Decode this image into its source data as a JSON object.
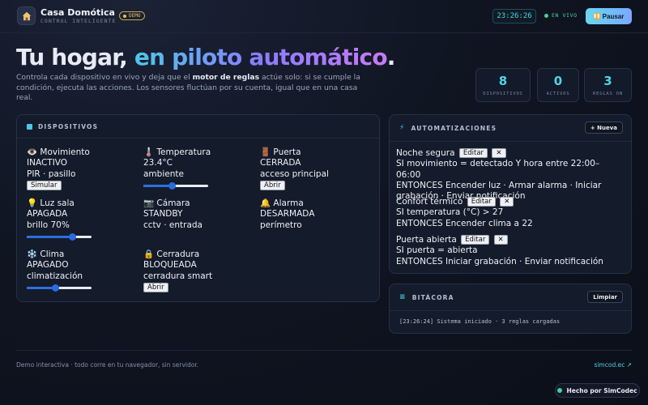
{
  "header": {
    "app_title": "Casa Domótica",
    "app_subtitle": "CONTROL INTELIGENTE",
    "badge": "DEMO",
    "clock": "23:26:26",
    "live": "EN VIVO",
    "pause_label": "Pausar"
  },
  "hero": {
    "title_plain": "Tu hogar, ",
    "title_accent": "en piloto automático",
    "title_end": ".",
    "desc_1": "Controla cada dispositivo en vivo y deja que el ",
    "desc_bold": "motor de reglas",
    "desc_2": " actúe solo: si se cumple la condición, ejecuta las acciones. Los sensores fluctúan por su cuenta, igual que en una casa real."
  },
  "stats": [
    {
      "value": "8",
      "label": "DISPOSITIVOS"
    },
    {
      "value": "0",
      "label": "ACTIVOS"
    },
    {
      "value": "3",
      "label": "REGLAS ON"
    }
  ],
  "devices_panel": {
    "title": "DISPOSITIVOS",
    "items": [
      {
        "icon": "👁️",
        "name": "Movimiento",
        "state": "INACTIVO",
        "detail": "PIR · pasillo",
        "button": "Simular"
      },
      {
        "icon": "🌡️",
        "name": "Temperatura",
        "state": "23.4°C",
        "detail": "ambiente",
        "slider": 0.44
      },
      {
        "icon": "🚪",
        "name": "Puerta",
        "state": "CERRADA",
        "detail": "acceso principal",
        "button": "Abrir"
      },
      {
        "icon": "💡",
        "name": "Luz sala",
        "state": "APAGADA",
        "detail": "brillo 70%",
        "slider": 0.7
      },
      {
        "icon": "📷",
        "name": "Cámara",
        "state": "STANDBY",
        "detail": "cctv · entrada"
      },
      {
        "icon": "🔔",
        "name": "Alarma",
        "state": "DESARMADA",
        "detail": "perímetro"
      },
      {
        "icon": "❄️",
        "name": "Clima",
        "state": "APAGADO",
        "detail": "climatización",
        "slider": 0.44
      },
      {
        "icon": "🔒",
        "name": "Cerradura",
        "state": "BLOQUEADA",
        "detail": "cerradura smart",
        "button": "Abrir"
      }
    ]
  },
  "automations_panel": {
    "title": "AUTOMATIZACIONES",
    "new_button": "+ Nueva",
    "edit_label": "Editar",
    "delete_label": "✕",
    "rules": [
      {
        "name": "Noche segura",
        "condition": "SI movimiento = detectado Y hora entre 22:00–06:00",
        "actions": "ENTONCES Encender luz · Armar alarma · Iniciar grabación · Enviar notificación"
      },
      {
        "name": "Confort térmico",
        "condition": "SI temperatura (°C) > 27",
        "actions": "ENTONCES Encender clima a 22"
      },
      {
        "name": "Puerta abierta",
        "condition": "SI puerta = abierta",
        "actions": "ENTONCES Iniciar grabación · Enviar notificación"
      }
    ]
  },
  "log_panel": {
    "title": "BITÁCORA",
    "clear_button": "Limpiar",
    "entries": [
      "[23:26:24] Sistema iniciado · 3 reglas cargadas"
    ]
  },
  "footer": {
    "text": "Demo interactiva · todo corre en tu navegador, sin servidor.",
    "link": "simcod.ec ↗",
    "made_by": "Hecho por SimCodec"
  },
  "colors": {
    "accent": "#4fd5e6",
    "slider": "#2d6fe0",
    "live": "#3fd39a"
  }
}
